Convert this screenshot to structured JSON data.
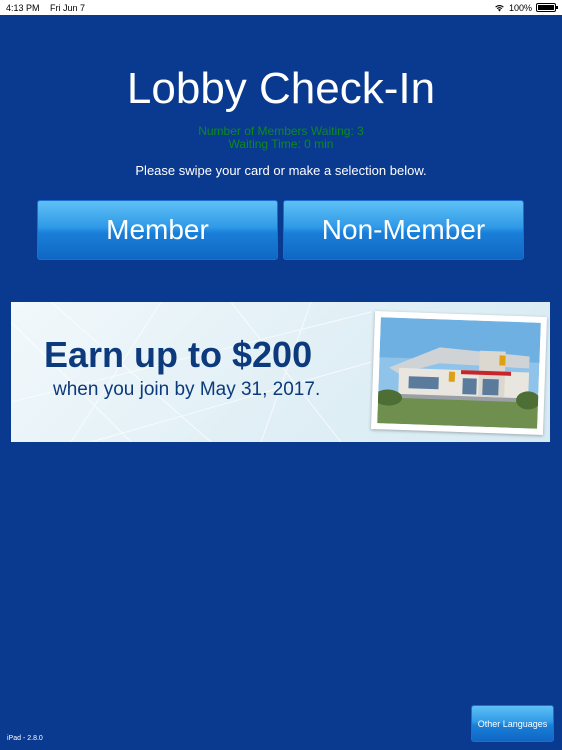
{
  "status_bar": {
    "time": "4:13 PM",
    "date": "Fri Jun 7",
    "battery": "100%",
    "wifi_icon": "wifi-icon",
    "battery_icon": "battery-icon"
  },
  "header": {
    "title": "Lobby Check-In"
  },
  "queue": {
    "members_waiting": "Number of Members Waiting: 3",
    "waiting_time": "Waiting Time: 0 min"
  },
  "instruction": "Please swipe your card or make a selection below.",
  "buttons": {
    "member": "Member",
    "non_member": "Non-Member"
  },
  "banner": {
    "headline": "Earn up to $200",
    "subline": "when you join by May 31, 2017."
  },
  "footer": {
    "other_languages": "Other Languages",
    "version": "iPad - 2.8.0"
  },
  "colors": {
    "background": "#0a3a8f",
    "queue_text": "#0c8a1a",
    "banner_text": "#0c3a7d",
    "button_top": "#5fc0f5",
    "button_bottom": "#0f67c4"
  }
}
